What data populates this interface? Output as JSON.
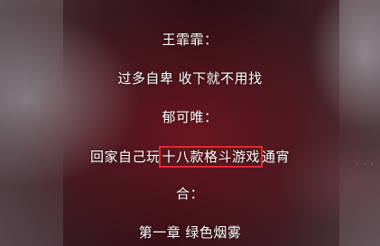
{
  "lyrics": [
    {
      "text": "王霏霏："
    },
    {
      "text": "过多自卑 收下就不用找"
    },
    {
      "text": "郁可唯："
    },
    {
      "before": "回家自己玩",
      "highlight": "十八款格斗游戏",
      "after": "通宵"
    },
    {
      "text": "合："
    },
    {
      "text": "第一章 绿色烟雾"
    }
  ],
  "colors": {
    "text": "#ffffff",
    "highlight_box": "#e02a2a"
  }
}
